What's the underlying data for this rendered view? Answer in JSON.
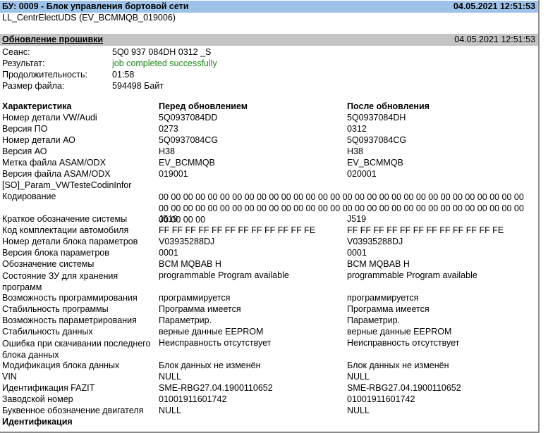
{
  "header": {
    "title": "БУ: 0009 - Блок управления бортовой сети",
    "timestamp": "04.05.2021 12:51:53",
    "subtitle": "LL_CentrElectUDS (EV_BCMMQB_019006)"
  },
  "section": {
    "title": "Обновление прошивки",
    "timestamp": "04.05.2021 12:51:53"
  },
  "info": [
    {
      "label": "Сеанс:",
      "value": "5Q0 937 084DH 0312 _S"
    },
    {
      "label": "Результат:",
      "value": "job completed successfully"
    },
    {
      "label": "Продолжительность:",
      "value": "01:58"
    },
    {
      "label": "Размер файла:",
      "value": "594498 Байт"
    }
  ],
  "table": {
    "headers": [
      "Характеристика",
      "Перед обновлением",
      "После обновления"
    ],
    "rows": [
      {
        "label": "Номер детали VW/Audi",
        "before": "5Q0937084DD",
        "after": "5Q0937084DH"
      },
      {
        "label": "Версия ПО",
        "before": "0273",
        "after": "0312"
      },
      {
        "label": "Номер детали АО",
        "before": "5Q0937084CG",
        "after": "5Q0937084CG"
      },
      {
        "label": "Версия АО",
        "before": "H38",
        "after": "H38"
      },
      {
        "label": "Метка файла ASAM/ODX",
        "before": "EV_BCMMQB",
        "after": "EV_BCMMQB"
      },
      {
        "label": "Версия файла ASAM/ODX",
        "before": "019001",
        "after": "020001"
      },
      {
        "label": "[SO]_Param_VWTesteCodinInfor",
        "before": "",
        "after": ""
      },
      {
        "label": "Кодирование",
        "before": "00 00 00 00 00 00 00 00 00 00 00 00 00 00 00 00 00 00 00 00 00 00 00 00 00 00 00 00 00 00 00 00 00 00 00 00 00 00 00 00 00 00 00 00 00 00 00 00 00 00 00 00 00 00 00 00 00 00 00 00 00 00 00 00",
        "after": ""
      },
      {
        "label": "Краткое обозначение системы",
        "before": "J519",
        "after": "J519"
      },
      {
        "label": "Код комплектации автомобиля",
        "before": "FF FF FF FF FF FF FF FF FF FF FF FE",
        "after": "FF FF FF FF FF FF FF FF FF FF FF FE"
      },
      {
        "label": "Номер детали блока параметров",
        "before": "V03935288DJ",
        "after": "V03935288DJ"
      },
      {
        "label": "Версия блока параметров",
        "before": "0001",
        "after": "0001"
      },
      {
        "label": "Обозначение системы",
        "before": "BCM MQBAB H",
        "after": "BCM MQBAB H"
      },
      {
        "label": "Состояние ЗУ для хранения программ",
        "before": "programmable Program available",
        "after": "programmable Program available"
      },
      {
        "label": "Возможность программирования",
        "before": "программируется",
        "after": "программируется"
      },
      {
        "label": "Стабильность программы",
        "before": "Программа имеется",
        "after": "Программа имеется"
      },
      {
        "label": "Возможность параметрирования",
        "before": "Параметрир.",
        "after": "Параметрир."
      },
      {
        "label": "Стабильность данных",
        "before": "верные данные EEPROM",
        "after": "верные данные EEPROM"
      },
      {
        "label": "Ошибка при скачивании последнего блока данных",
        "before": "Неисправность отсутствует",
        "after": "Неисправность отсутствует"
      },
      {
        "label": "Модификация блока данных",
        "before": "Блок данных не изменён",
        "after": "Блок данных не изменён"
      },
      {
        "label": "VIN",
        "before": "NULL",
        "after": "NULL"
      },
      {
        "label": "Идентификация FAZIT",
        "before": "SME-RBG27.04.1900110652",
        "after": "SME-RBG27.04.1900110652"
      },
      {
        "label": "Заводской номер",
        "before": "01001911601742",
        "after": "01001911601742"
      },
      {
        "label": "Буквенное обозначение двигателя",
        "before": "NULL",
        "after": "NULL"
      }
    ],
    "footer": "Идентификация"
  }
}
